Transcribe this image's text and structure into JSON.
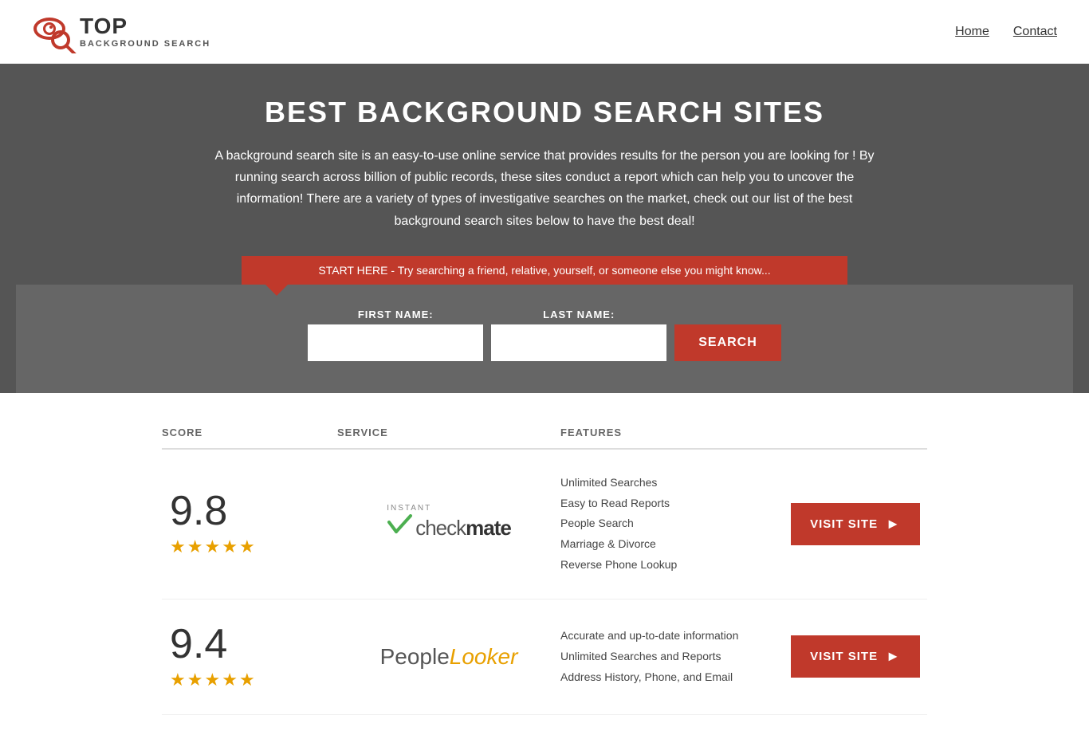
{
  "header": {
    "logo_top": "TOP",
    "logo_bottom_line1": "BACKGROUND",
    "logo_bottom_line2": "SEARCH",
    "nav": {
      "home": "Home",
      "contact": "Contact"
    }
  },
  "hero": {
    "title": "BEST BACKGROUND SEARCH SITES",
    "description": "A background search site is an easy-to-use online service that provides results  for the person you are looking for ! By  running  search across billion of public records, these sites conduct  a report which can help you to uncover the information! There are a variety of types of investigative searches on the market, check out our  list of the best background search sites below to have the best deal!",
    "search_banner": "START HERE - Try searching a friend, relative, yourself, or someone else you might know..."
  },
  "search_form": {
    "first_name_label": "FIRST NAME:",
    "last_name_label": "LAST NAME:",
    "search_button": "SEARCH"
  },
  "results": {
    "headers": {
      "score": "SCORE",
      "service": "SERVICE",
      "features": "FEATURES",
      "action": ""
    },
    "rows": [
      {
        "score": "9.8",
        "stars": [
          true,
          true,
          true,
          true,
          "half"
        ],
        "service_name": "Instant Checkmate",
        "service_type": "checkmate",
        "features": [
          "Unlimited Searches",
          "Easy to Read Reports",
          "People Search",
          "Marriage & Divorce",
          "Reverse Phone Lookup"
        ],
        "visit_label": "VISIT SITE"
      },
      {
        "score": "9.4",
        "stars": [
          true,
          true,
          true,
          true,
          "half"
        ],
        "service_name": "PeopleLooker",
        "service_type": "peoplelooker",
        "features": [
          "Accurate and up-to-date information",
          "Unlimited Searches and Reports",
          "Address History, Phone, and Email"
        ],
        "visit_label": "VISIT SITE"
      }
    ]
  },
  "colors": {
    "red": "#c0392b",
    "dark_bg": "#555555",
    "star_gold": "#e8a000"
  }
}
